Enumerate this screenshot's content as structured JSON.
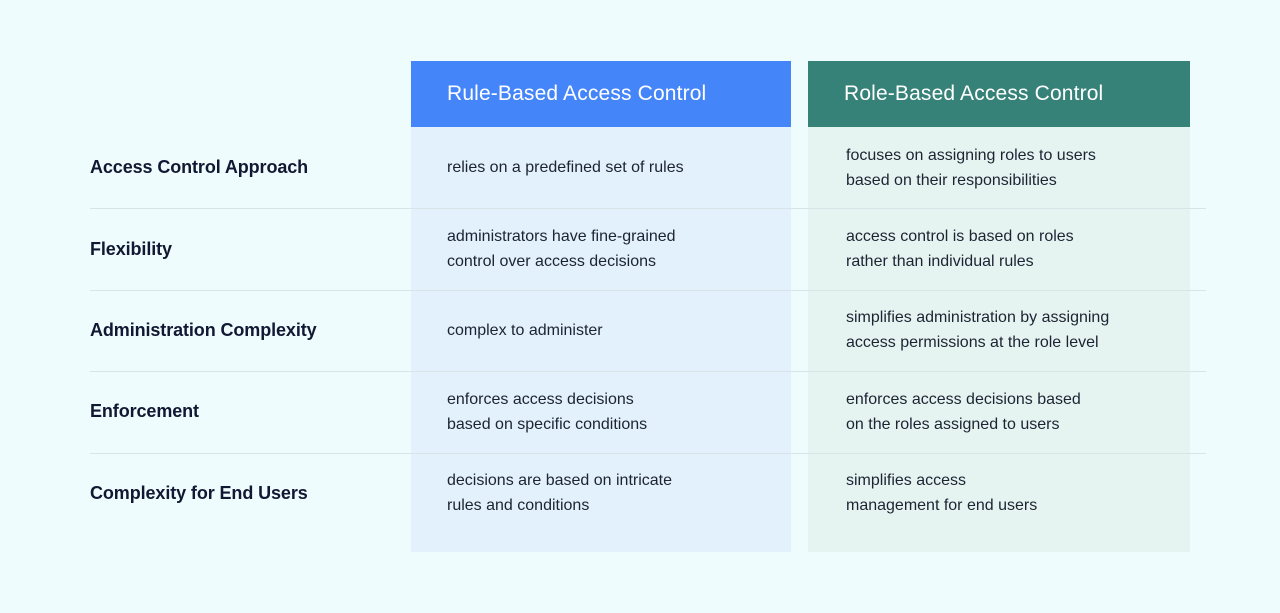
{
  "table": {
    "row_label_header": "",
    "columns": [
      {
        "id": "rule-based",
        "title": "Rule-Based Access Control",
        "header_color": "#4585fa",
        "body_color": "#e3f1fc"
      },
      {
        "id": "role-based",
        "title": "Role-Based Access Control",
        "header_color": "#368278",
        "body_color": "#e6f4f1"
      }
    ],
    "rows": [
      {
        "label": "Access Control Approach",
        "rule_based": "relies on a predefined set of rules",
        "role_based": "focuses on assigning roles to users\nbased on their responsibilities"
      },
      {
        "label": "Flexibility",
        "rule_based": "administrators have fine-grained\ncontrol over access decisions",
        "role_based": "access control is based on roles\nrather than individual rules"
      },
      {
        "label": "Administration Complexity",
        "rule_based": "complex to administer",
        "role_based": "simplifies administration by assigning\naccess permissions at the role level"
      },
      {
        "label": "Enforcement",
        "rule_based": "enforces access decisions\nbased on specific conditions",
        "role_based": "enforces access decisions based\non the roles assigned to users"
      },
      {
        "label": "Complexity for End Users",
        "rule_based": "decisions are based on intricate\nrules and conditions",
        "role_based": "simplifies access\nmanagement for end users"
      }
    ]
  },
  "theme": {
    "page_background": "#eefcfd",
    "divider_color": "#d9e4e8",
    "label_text_color": "#121833",
    "cell_text_color": "#1c2333",
    "header_text_color": "#ffffff"
  }
}
